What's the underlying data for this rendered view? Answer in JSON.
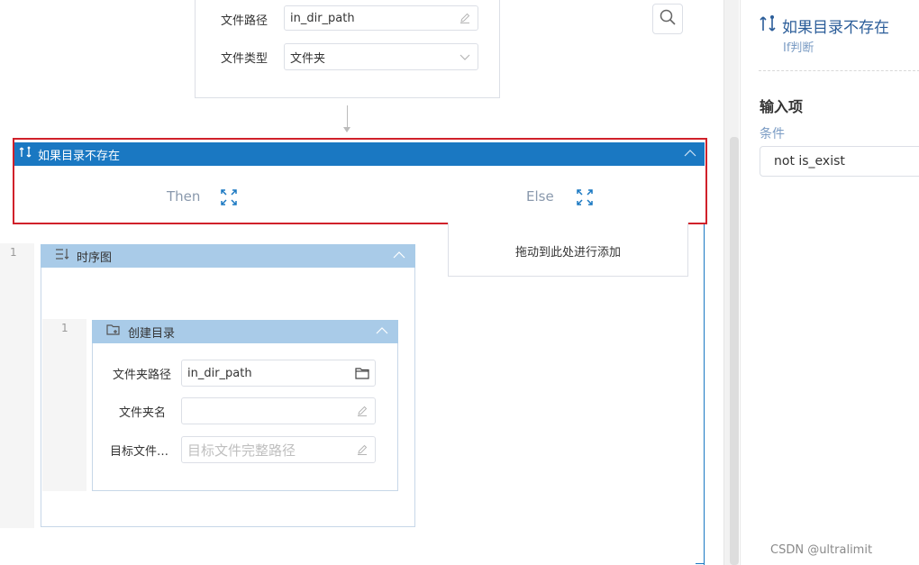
{
  "top_node": {
    "file_path_label": "文件路径",
    "file_path_value": "in_dir_path",
    "file_type_label": "文件类型",
    "file_type_value": "文件夹"
  },
  "if_node": {
    "title": "如果目录不存在",
    "then_label": "Then",
    "else_label": "Else",
    "else_drop_hint": "拖动到此处进行添加"
  },
  "sequence": {
    "line_number": "1",
    "title": "时序图"
  },
  "create_dir": {
    "line_number": "1",
    "title": "创建目录",
    "folder_path_label": "文件夹路径",
    "folder_path_value": "in_dir_path",
    "folder_name_label": "文件夹名",
    "folder_name_value": "",
    "target_label": "目标文件…",
    "target_placeholder": "目标文件完整路径"
  },
  "panel": {
    "title": "如果目录不存在",
    "subtitle": "If判断",
    "section": "输入项",
    "condition_label": "条件",
    "condition_value": "not is_exist"
  },
  "watermark": "CSDN @ultralimit",
  "colors": {
    "accent": "#1a78c2",
    "highlight_frame": "#d0212a",
    "sub_header": "#a9cbe8"
  },
  "icons": {
    "branch": "if-branch-icon",
    "edit": "pencil-icon",
    "dropdown": "chevron-down-icon",
    "collapse": "chevron-up-icon",
    "expand": "expand-arrows-icon",
    "sequence": "sequence-icon",
    "folder_add": "folder-add-icon",
    "folder": "folder-icon",
    "search": "search-icon"
  }
}
